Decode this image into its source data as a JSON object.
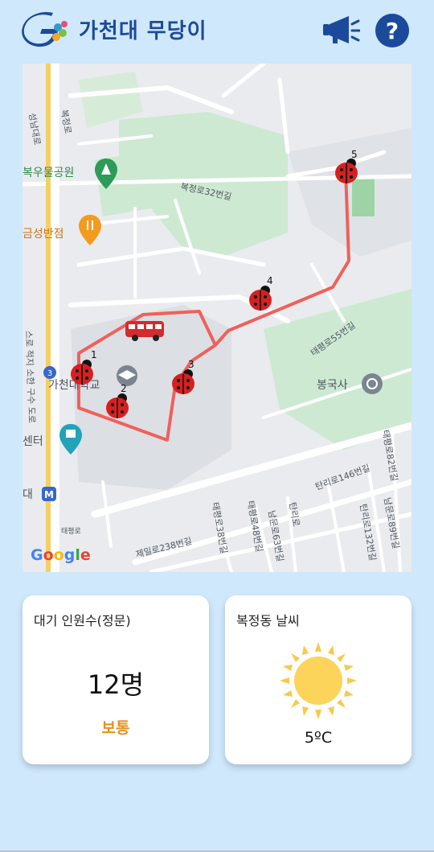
{
  "header": {
    "title": "가천대 무당이",
    "announce_icon": "megaphone-icon",
    "help_icon": "question-mark-icon",
    "brand_color": "#1c4a9a"
  },
  "map": {
    "labels": {
      "bokjeong_ro": "복정로",
      "seongnam_daero": "성남대로",
      "park": "복우물공원",
      "restaurant": "금성반점",
      "bokjeong32": "복정로32번길",
      "gachon_univ": "가천대학교",
      "taepyeong55": "태평로55번길",
      "bongguksa": "봉국사",
      "center": "센터",
      "station": "대",
      "metro": "M",
      "exit3": "3",
      "taepyeong": "태평로",
      "jeil238": "제일로238번길",
      "taepyeong38": "태평로38번길",
      "taepyeong48": "태평로48번길",
      "nammun63": "남문로63번길",
      "tanri": "탄리로",
      "tanri146": "탄리로146번길",
      "taepyeong82": "태평로82번길",
      "tanri132": "탄리로132번길",
      "nammun89": "남문로89번길",
      "highway": "스로 적지 소한 구수 도로",
      "google": "Google"
    },
    "stops": [
      "1",
      "2",
      "3",
      "4",
      "5"
    ],
    "route_color": "#f0605a",
    "stop_icon": "ladybug-icon",
    "bus_icon": "bus-icon"
  },
  "waiting": {
    "title": "대기 인원수(정문)",
    "count": "12명",
    "status": "보통",
    "status_color": "#e8901a"
  },
  "weather": {
    "title": "복정동 날씨",
    "icon": "sun-icon",
    "temperature": "5ºC"
  }
}
